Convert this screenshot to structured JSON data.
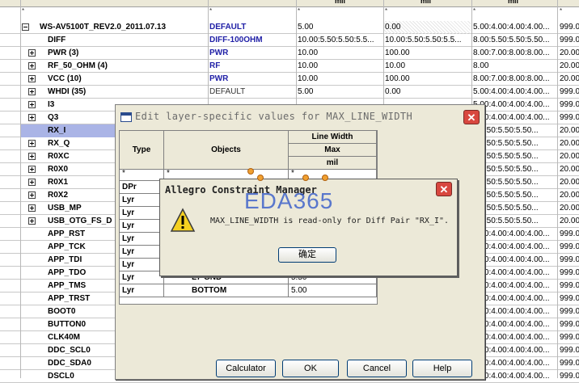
{
  "spreadsheet": {
    "header_units": [
      "mil",
      "mil",
      "mil"
    ],
    "filter_star": "*",
    "rows": [
      {
        "name": "WS-AV5100T_REV2.0_2011.07.13",
        "cset": "DEFAULT",
        "v1": "5.00",
        "v2": "0.00",
        "v3": "5.00:4.00:4.00:4.00...",
        "v4": "999.0",
        "expander": "minus",
        "level": "top",
        "cset_blue": true,
        "v2_hatch": true
      },
      {
        "name": "DIFF",
        "cset": "DIFF-100OHM",
        "v1": "10.00:5.50:5.50:5.5...",
        "v2": "10.00:5.50:5.50:5.5...",
        "v3": "8.00:5.50:5.50:5.50...",
        "v4": "999.0",
        "expander": "none",
        "cset_blue": true
      },
      {
        "name": "PWR (3)",
        "cset": "PWR",
        "v1": "10.00",
        "v2": "100.00",
        "v3": "8.00:7.00:8.00:8.00...",
        "v4": "20.00",
        "expander": "plus",
        "cset_blue": true
      },
      {
        "name": "RF_50_OHM (4)",
        "cset": "RF",
        "v1": "10.00",
        "v2": "10.00",
        "v3": "8.00",
        "v4": "20.00",
        "expander": "plus",
        "cset_blue": true
      },
      {
        "name": "VCC (10)",
        "cset": "PWR",
        "v1": "10.00",
        "v2": "100.00",
        "v3": "8.00:7.00:8.00:8.00...",
        "v4": "20.00",
        "expander": "plus",
        "cset_blue": true
      },
      {
        "name": "WHDI (35)",
        "cset": "DEFAULT",
        "v1": "5.00",
        "v2": "0.00",
        "v3": "5.00:4.00:4.00:4.00...",
        "v4": "999.0",
        "expander": "plus",
        "cset_blue": false
      },
      {
        "name": "I3",
        "cset": "",
        "v1": "",
        "v2": "",
        "v3": "5.00:4.00:4.00:4.00...",
        "v4": "999.0",
        "expander": "plus"
      },
      {
        "name": "Q3",
        "cset": "",
        "v1": "",
        "v2": "",
        "v3": "5.00:4.00:4.00:4.00...",
        "v4": "999.0",
        "expander": "plus"
      },
      {
        "name": "RX_I",
        "cset": "",
        "v1": "",
        "v2": "",
        "v3": "0:5.50:5.50:5.50...",
        "v4": "20.00",
        "expander": "plus",
        "selected": true
      },
      {
        "name": "RX_Q",
        "cset": "",
        "v1": "",
        "v2": "",
        "v3": "0:5.50:5.50:5.50...",
        "v4": "20.00",
        "expander": "plus"
      },
      {
        "name": "R0XC",
        "cset": "",
        "v1": "",
        "v2": "",
        "v3": "0:5.50:5.50:5.50...",
        "v4": "20.00",
        "expander": "plus"
      },
      {
        "name": "R0X0",
        "cset": "",
        "v1": "",
        "v2": "",
        "v3": "0:5.50:5.50:5.50...",
        "v4": "20.00",
        "expander": "plus"
      },
      {
        "name": "R0X1",
        "cset": "",
        "v1": "",
        "v2": "",
        "v3": "0:5.50:5.50:5.50...",
        "v4": "20.00",
        "expander": "plus"
      },
      {
        "name": "R0X2",
        "cset": "",
        "v1": "",
        "v2": "",
        "v3": "0:5.50:5.50:5.50...",
        "v4": "20.00",
        "expander": "plus"
      },
      {
        "name": "USB_MP",
        "cset": "",
        "v1": "",
        "v2": "",
        "v3": "0:5.50:5.50:5.50...",
        "v4": "20.00",
        "expander": "plus"
      },
      {
        "name": "USB_OTG_FS_D",
        "cset": "",
        "v1": "",
        "v2": "",
        "v3": "0:5.50:5.50:5.50...",
        "v4": "20.00",
        "expander": "plus"
      },
      {
        "name": "APP_RST",
        "cset": "",
        "v1": "",
        "v2": "",
        "v3": "5.00:4.00:4.00:4.00...",
        "v4": "999.0",
        "expander": "none"
      },
      {
        "name": "APP_TCK",
        "cset": "",
        "v1": "",
        "v2": "",
        "v3": "5.00:4.00:4.00:4.00...",
        "v4": "999.0",
        "expander": "none"
      },
      {
        "name": "APP_TDI",
        "cset": "",
        "v1": "",
        "v2": "",
        "v3": "5.00:4.00:4.00:4.00...",
        "v4": "999.0",
        "expander": "none"
      },
      {
        "name": "APP_TDO",
        "cset": "",
        "v1": "",
        "v2": "",
        "v3": "5.00:4.00:4.00:4.00...",
        "v4": "999.0",
        "expander": "none"
      },
      {
        "name": "APP_TMS",
        "cset": "",
        "v1": "",
        "v2": "",
        "v3": "5.00:4.00:4.00:4.00...",
        "v4": "999.0",
        "expander": "none"
      },
      {
        "name": "APP_TRST",
        "cset": "",
        "v1": "",
        "v2": "",
        "v3": "5.00:4.00:4.00:4.00...",
        "v4": "999.0",
        "expander": "none"
      },
      {
        "name": "BOOT0",
        "cset": "",
        "v1": "",
        "v2": "",
        "v3": "5.00:4.00:4.00:4.00...",
        "v4": "999.0",
        "expander": "none"
      },
      {
        "name": "BUTTON0",
        "cset": "",
        "v1": "",
        "v2": "",
        "v3": "5.00:4.00:4.00:4.00...",
        "v4": "999.0",
        "expander": "none"
      },
      {
        "name": "CLK40M",
        "cset": "",
        "v1": "",
        "v2": "",
        "v3": "5.00:4.00:4.00:4.00...",
        "v4": "999.0",
        "expander": "none"
      },
      {
        "name": "DDC_SCL0",
        "cset": "",
        "v1": "",
        "v2": "",
        "v3": "5.00:4.00:4.00:4.00...",
        "v4": "999.0",
        "expander": "none"
      },
      {
        "name": "DDC_SDA0",
        "cset": "",
        "v1": "",
        "v2": "",
        "v3": "5.00:4.00:4.00:4.00...",
        "v4": "999.0",
        "expander": "none"
      },
      {
        "name": "DSCL0",
        "cset": "",
        "v1": "",
        "v2": "",
        "v3": "5.00:4.00:4.00:4.00...",
        "v4": "999.0",
        "expander": "none"
      }
    ]
  },
  "edit_dialog": {
    "title": "Edit layer-specific values for MAX_LINE_WIDTH",
    "col_type": "Type",
    "col_objects": "Objects",
    "col_line_width": "Line Width",
    "col_max": "Max",
    "col_unit": "mil",
    "filter_star": "*",
    "rows": [
      {
        "type": "DPr",
        "object": "",
        "value": ""
      },
      {
        "type": "Lyr",
        "object": "",
        "value": ""
      },
      {
        "type": "Lyr",
        "object": "",
        "value": ""
      },
      {
        "type": "Lyr",
        "object": "",
        "value": ""
      },
      {
        "type": "Lyr",
        "object": "",
        "value": ""
      },
      {
        "type": "Lyr",
        "object": "",
        "value": ""
      },
      {
        "type": "Lyr",
        "object": "",
        "value": ""
      },
      {
        "type": "Lyr",
        "object": "L7-GND",
        "value": "5.50"
      },
      {
        "type": "Lyr",
        "object": "BOTTOM",
        "value": "5.00"
      }
    ],
    "buttons": {
      "calculator": "Calculator",
      "ok": "OK",
      "cancel": "Cancel",
      "help": "Help"
    }
  },
  "message_box": {
    "title": "Allegro Constraint Manager",
    "message": "MAX_LINE_WIDTH is read-only for Diff Pair \"RX_I\".",
    "ok_label": "确定",
    "close_label": "X"
  },
  "watermark": "EDA365"
}
